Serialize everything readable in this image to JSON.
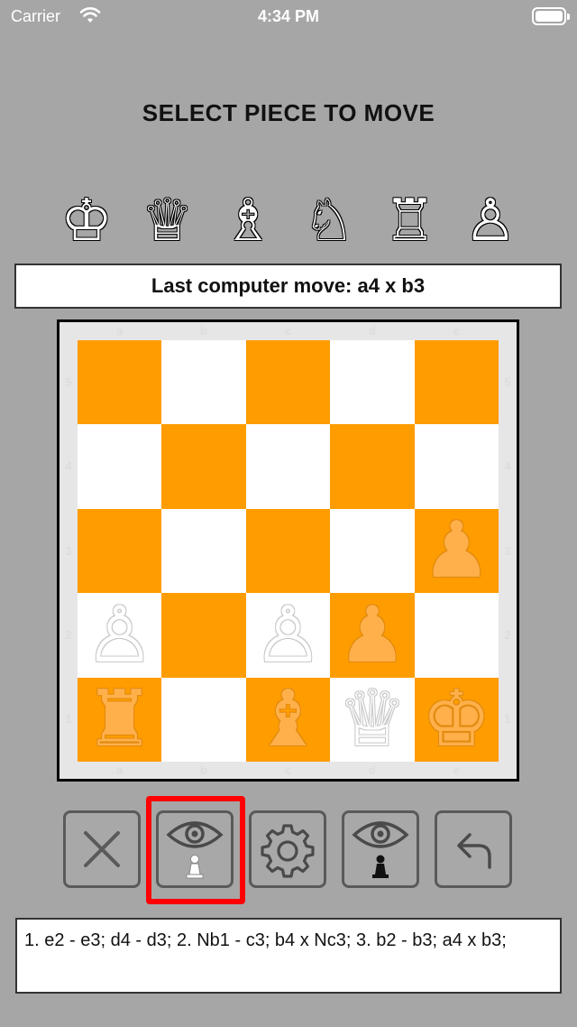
{
  "status_bar": {
    "carrier": "Carrier",
    "time": "4:34 PM",
    "wifi_icon": "wifi-icon",
    "battery_icon": "battery-icon"
  },
  "title": "SELECT PIECE TO MOVE",
  "piece_picker": [
    {
      "name": "king",
      "glyph": "♔"
    },
    {
      "name": "queen",
      "glyph": "♕"
    },
    {
      "name": "bishop",
      "glyph": "♗"
    },
    {
      "name": "knight",
      "glyph": "♘"
    },
    {
      "name": "rook",
      "glyph": "♖"
    },
    {
      "name": "pawn",
      "glyph": "♙"
    }
  ],
  "last_move": "Last computer move: a4 x b3",
  "board": {
    "files": [
      "a",
      "b",
      "c",
      "d",
      "e"
    ],
    "ranks": [
      "5",
      "4",
      "3",
      "2",
      "1"
    ],
    "colors": {
      "dark": "#ff9c00",
      "light": "#ffffff"
    },
    "pieces": [
      {
        "square": "e3",
        "glyph": "♟",
        "side": "computer"
      },
      {
        "square": "a2",
        "glyph": "♙",
        "side": "player"
      },
      {
        "square": "c2",
        "glyph": "♙",
        "side": "player"
      },
      {
        "square": "d2",
        "glyph": "♟",
        "side": "computer"
      },
      {
        "square": "a1",
        "glyph": "♜",
        "side": "computer"
      },
      {
        "square": "c1",
        "glyph": "♝",
        "side": "computer"
      },
      {
        "square": "d1",
        "glyph": "♕",
        "side": "player"
      },
      {
        "square": "e1",
        "glyph": "♚",
        "side": "computer"
      }
    ]
  },
  "toolbar": [
    {
      "name": "close-button",
      "icon": "close-icon"
    },
    {
      "name": "show-player-moves-button",
      "icon": "eye-white-pawn-icon"
    },
    {
      "name": "settings-button",
      "icon": "gear-icon"
    },
    {
      "name": "show-computer-moves-button",
      "icon": "eye-black-pawn-icon"
    },
    {
      "name": "undo-button",
      "icon": "undo-arrow-icon"
    }
  ],
  "highlight_color": "#ff0000",
  "move_history": "1. e2 - e3;  d4 - d3; 2. Nb1 - c3;  b4 x Nc3; 3. b2 - b3;  a4 x b3;"
}
